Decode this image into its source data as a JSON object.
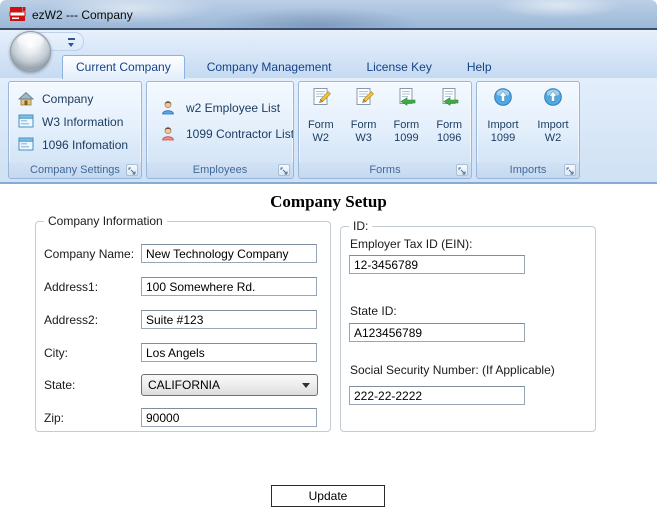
{
  "window": {
    "title": "ezW2 --- Company",
    "app_icon": "red-printer-icon"
  },
  "qat": {
    "customize_icon": "chevron-down-icon"
  },
  "tabs": [
    {
      "label": "Current Company",
      "selected": true
    },
    {
      "label": "Company Management",
      "selected": false
    },
    {
      "label": "License Key",
      "selected": false
    },
    {
      "label": "Help",
      "selected": false
    }
  ],
  "ribbon": {
    "groups": [
      {
        "label": "Company Settings",
        "items": [
          {
            "label": "Company",
            "icon": "home-icon"
          },
          {
            "label": "W3 Information",
            "icon": "form-window-icon"
          },
          {
            "label": "1096 Infomation",
            "icon": "form-window-icon"
          }
        ]
      },
      {
        "label": "Employees",
        "items": [
          {
            "label": "w2 Employee List",
            "icon": "person-blue-icon"
          },
          {
            "label": "1099 Contractor List",
            "icon": "person-red-icon"
          }
        ]
      },
      {
        "label": "Forms",
        "items": [
          {
            "label": "Form W2",
            "icon": "document-edit-icon"
          },
          {
            "label": "Form W3",
            "icon": "document-edit-icon"
          },
          {
            "label": "Form 1099",
            "icon": "document-arrow-icon"
          },
          {
            "label": "Form 1096",
            "icon": "document-arrow-icon"
          }
        ]
      },
      {
        "label": "Imports",
        "items": [
          {
            "label": "Import 1099",
            "icon": "import-up-icon"
          },
          {
            "label": "Import W2",
            "icon": "import-up-icon"
          }
        ]
      }
    ]
  },
  "content": {
    "heading": "Company Setup",
    "company_info": {
      "legend": "Company Information",
      "fields": [
        {
          "label": "Company Name:",
          "value": "New Technology Company"
        },
        {
          "label": "Address1:",
          "value": "100 Somewhere Rd."
        },
        {
          "label": "Address2:",
          "value": "Suite #123"
        },
        {
          "label": "City:",
          "value": "Los Angels"
        },
        {
          "label": "State:",
          "value": "CALIFORNIA"
        },
        {
          "label": "Zip:",
          "value": "90000"
        }
      ]
    },
    "id_section": {
      "legend": "ID:",
      "fields": [
        {
          "label": "Employer Tax ID (EIN):",
          "value": "12-3456789"
        },
        {
          "label": "State ID:",
          "value": "A123456789"
        },
        {
          "label": "Social Security Number: (If Applicable)",
          "value": "222-22-2222"
        }
      ]
    },
    "update_button": "Update"
  },
  "colors": {
    "accent_navy": "#15428b",
    "ribbon_blue": "#d5e5f7",
    "group_label_text": "#41699a",
    "app_icon_red": "#cc1111",
    "titlebar_border": "#3b4e66"
  }
}
